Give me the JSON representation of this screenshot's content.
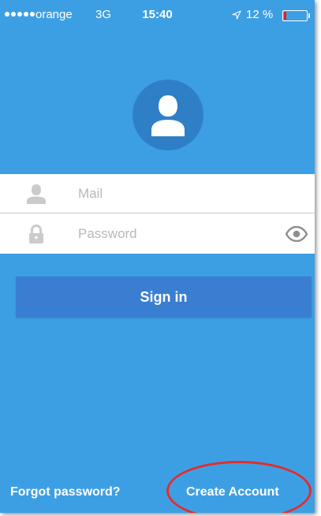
{
  "status_bar": {
    "carrier": "orange",
    "network": "3G",
    "time": "15:40",
    "battery_percent": "12 %",
    "battery_level": 0.12
  },
  "login": {
    "mail_placeholder": "Mail",
    "password_placeholder": "Password",
    "signin_label": "Sign in",
    "forgot_label": "Forgot password?",
    "create_label": "Create Account"
  },
  "icons": {
    "avatar": "user-silhouette-icon",
    "mail_field": "user-icon",
    "password_field": "lock-icon",
    "password_toggle": "eye-icon",
    "location": "location-arrow-icon"
  },
  "colors": {
    "background": "#3d9fe3",
    "avatar_circle": "#2f7fc6",
    "signin_button": "#3a7ed2",
    "battery_low": "#e02020",
    "annotation": "#e52b2b"
  }
}
